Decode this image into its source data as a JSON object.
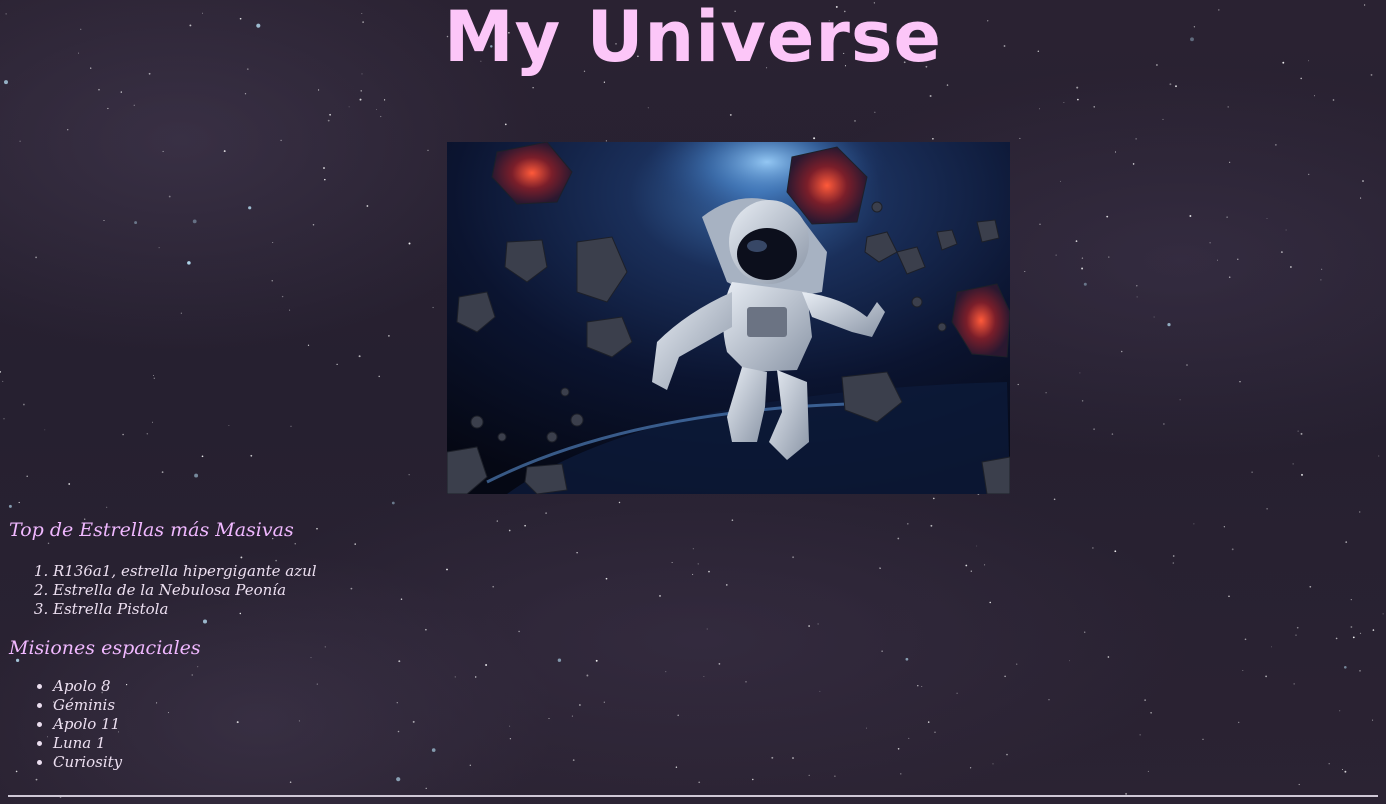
{
  "header": {
    "title": "My Universe"
  },
  "hero_image": {
    "alt": "Astronaut floating in space among asteroids"
  },
  "stars_section": {
    "heading": "Top de Estrellas más Masivas",
    "items": [
      "R136a1, estrella hipergigante azul",
      "Estrella de la Nebulosa Peonía",
      "Estrella Pistola"
    ]
  },
  "missions_section": {
    "heading": "Misiones espaciales",
    "items": [
      "Apolo 8",
      "Géminis",
      "Apolo 11",
      "Luna 1",
      "Curiosity"
    ]
  },
  "colors": {
    "title": "#fcc6f8",
    "heading": "#f0b8ff",
    "background": "#27202f"
  }
}
